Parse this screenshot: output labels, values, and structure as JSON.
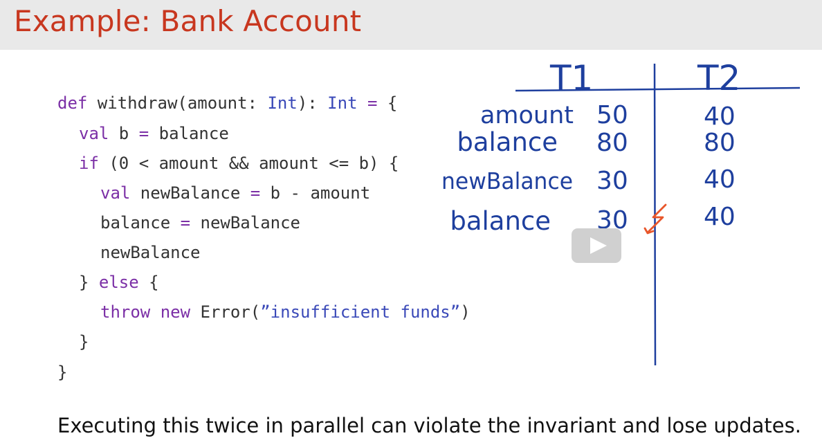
{
  "slide": {
    "title": "Example: Bank Account",
    "caption": "Executing this twice in parallel can violate the invariant and lose updates."
  },
  "code": {
    "line1": {
      "kw1": "def",
      "name": " withdraw(amount: ",
      "type1": "Int",
      "mid": "): ",
      "type2": "Int",
      "op": " =",
      "end": " {"
    },
    "line2": {
      "kw": "val",
      "rest1": " b ",
      "op": "=",
      "rest2": " balance"
    },
    "line3": {
      "kw": "if",
      "rest": " (0 < amount && amount <= b) {"
    },
    "line4": {
      "kw": "val",
      "rest1": " newBalance ",
      "op": "=",
      "rest2": " b - amount"
    },
    "line5": {
      "rest1": "balance ",
      "op": "=",
      "rest2": " newBalance"
    },
    "line6": {
      "rest": "newBalance"
    },
    "line7": {
      "pre": "} ",
      "kw": "else",
      "rest": " {"
    },
    "line8": {
      "kw1": "throw",
      "sp": " ",
      "kw2": "new",
      "rest1": " Error(",
      "str": "”insufficient funds”",
      "rest2": ")"
    },
    "line9": {
      "rest": "}"
    },
    "line10": {
      "rest": "}"
    }
  },
  "table": {
    "col1": "T1",
    "col2": "T2",
    "rows": [
      {
        "label": "amount",
        "t1": "50",
        "t2": "40"
      },
      {
        "label": "balance",
        "t1": "80",
        "t2": "80"
      },
      {
        "label": "newBalance",
        "t1": "30",
        "t2": "40"
      },
      {
        "label": "balance",
        "t1": "30",
        "t2": "40"
      }
    ],
    "ink_color": "#1e3f9e",
    "conflict_color": "#e8562a"
  },
  "icons": {
    "play": "play-icon",
    "conflict": "lightning-icon"
  }
}
